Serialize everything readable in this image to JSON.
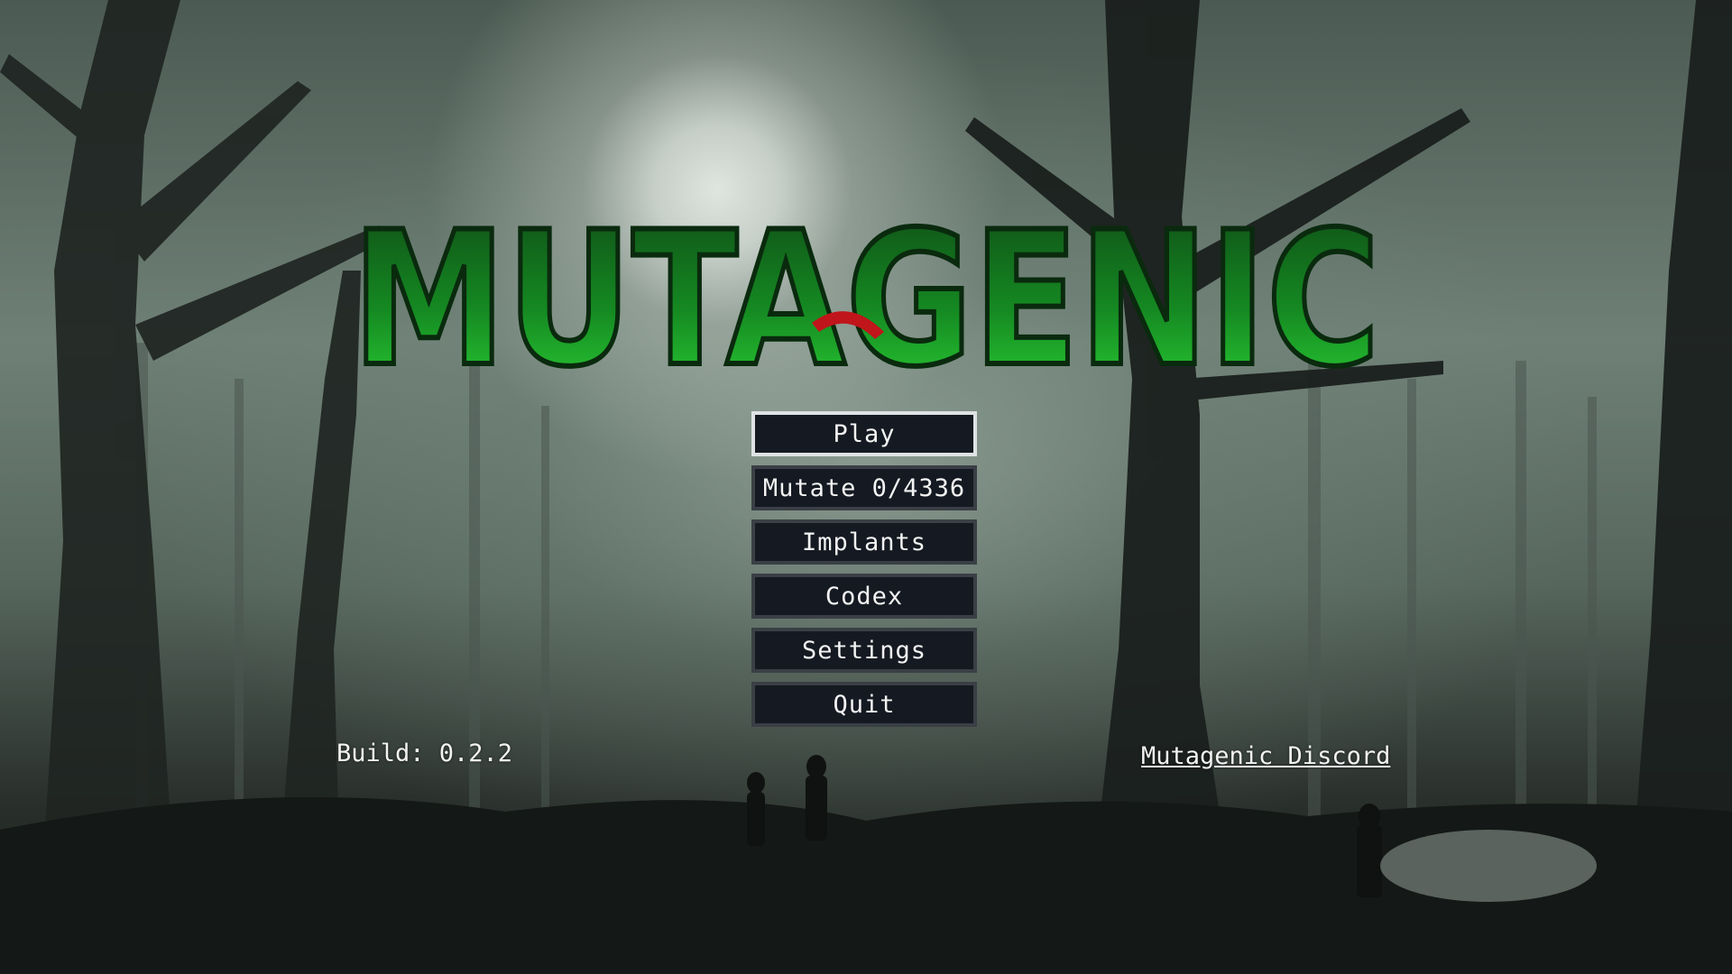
{
  "game": {
    "title": "MUTAGENIC",
    "title_color": "#1e9b2a",
    "accent_red": "#c0151a"
  },
  "menu": {
    "items": [
      {
        "label": "Play",
        "selected": true
      },
      {
        "label": "Mutate 0/4336",
        "selected": false
      },
      {
        "label": "Implants",
        "selected": false
      },
      {
        "label": "Codex",
        "selected": false
      },
      {
        "label": "Settings",
        "selected": false
      },
      {
        "label": "Quit",
        "selected": false
      }
    ]
  },
  "footer": {
    "build": "Build: 0.2.2",
    "discord_link": "Mutagenic Discord"
  }
}
